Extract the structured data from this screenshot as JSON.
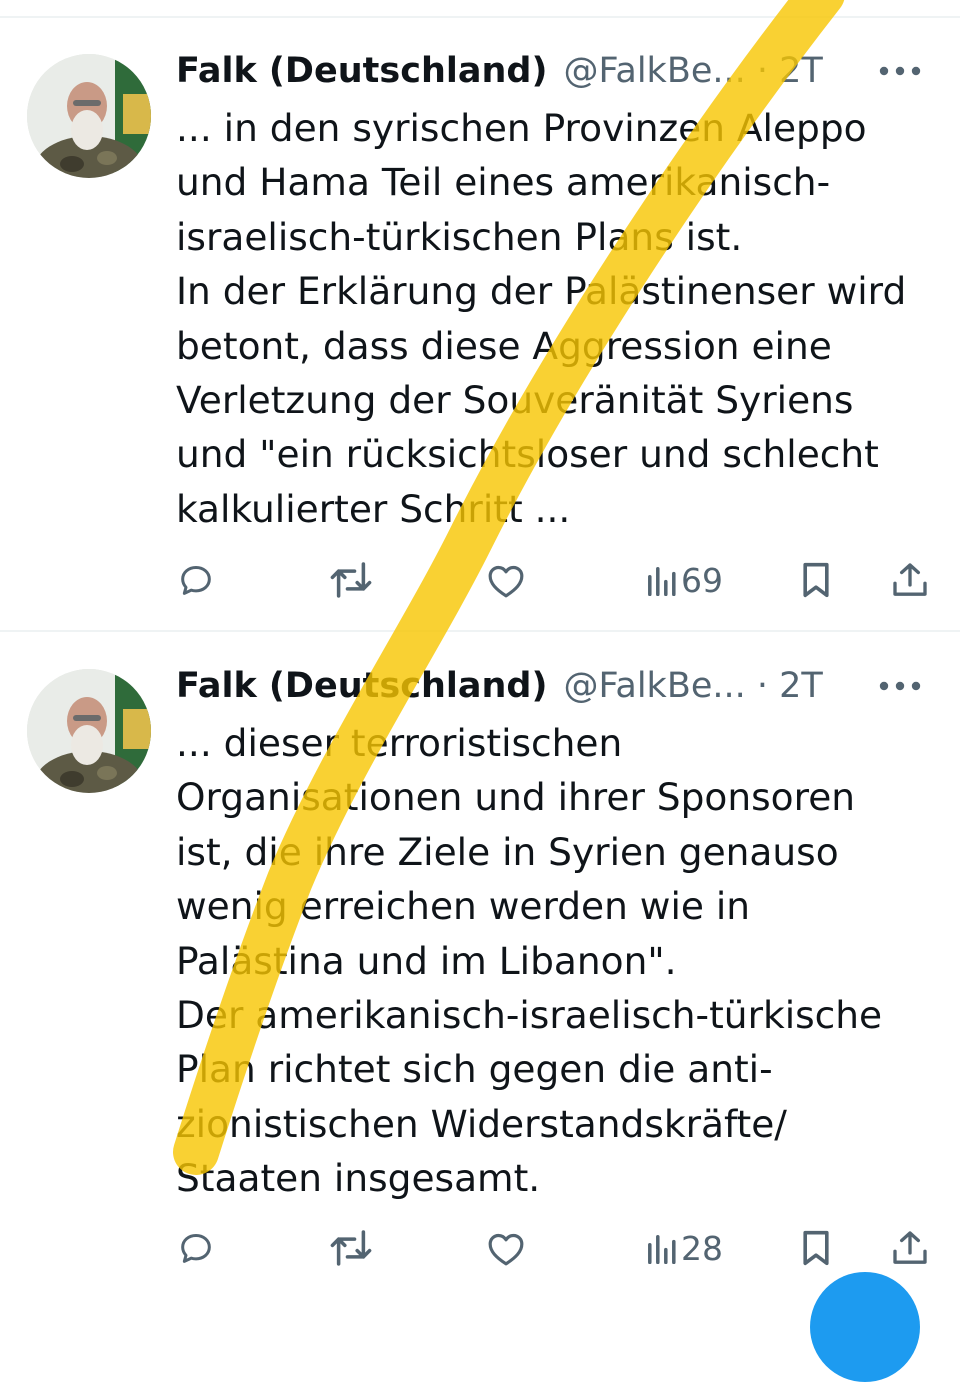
{
  "tweets": [
    {
      "author_name": "Falk (Deutschland)",
      "handle_time": "@FalkBe... · 2T",
      "lines": [
        "... in den syrischen Provinzen Aleppo",
        "und Hama Teil eines amerikanisch-",
        "israelisch-türkischen Plans ist.",
        "In der Erklärung der Palästinenser wird",
        "betont, dass diese Aggression eine",
        "Verletzung der Souveränität Syriens",
        "und \"ein rücksichtsloser und schlecht",
        "kalkulierter Schritt ..."
      ],
      "views": "69"
    },
    {
      "author_name": "Falk (Deutschland)",
      "handle_time": "@FalkBe... · 2T",
      "lines": [
        "... dieser terroristischen",
        "Organisationen und ihrer Sponsoren",
        "ist, die ihre Ziele in Syrien genauso",
        "wenig erreichen werden wie in",
        "Palästina und im Libanon\".",
        "Der amerikanisch-israelisch-türkische",
        "Plan richtet sich gegen die anti-",
        "zionistischen Widerstandskräfte/",
        "Staaten insgesamt."
      ],
      "views": "28"
    }
  ],
  "icons": {
    "more": "more-horizontal-icon",
    "reply": "reply-icon",
    "retweet": "retweet-icon",
    "like": "heart-icon",
    "views": "views-chart-icon",
    "bookmark": "bookmark-icon",
    "share": "share-icon"
  },
  "colors": {
    "text": "#0f1419",
    "secondary": "#536471",
    "divider": "#eff3f4",
    "highlight_marker": "#f7c600",
    "accent": "#1d9bf0"
  }
}
